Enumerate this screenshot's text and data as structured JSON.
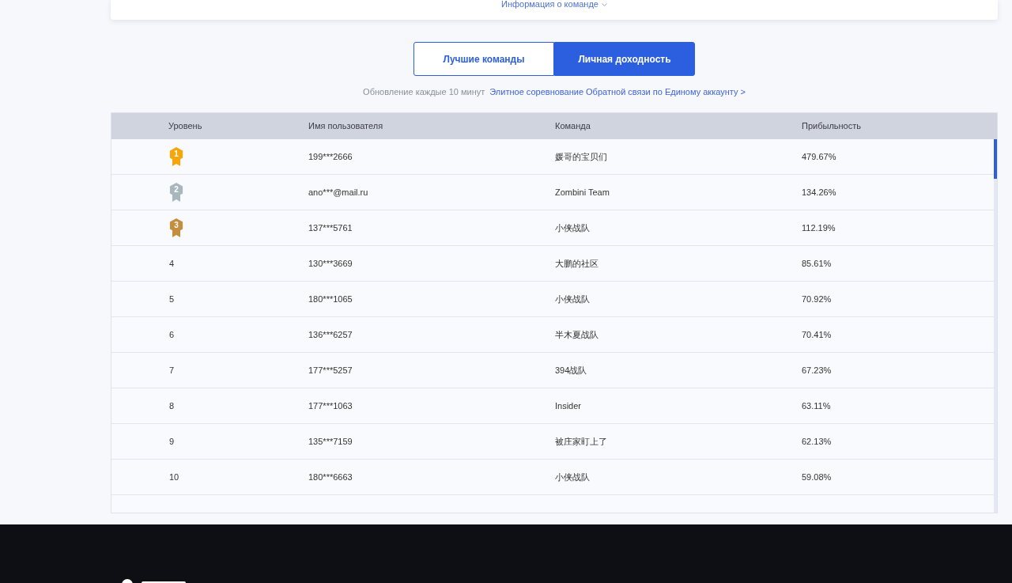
{
  "team_info": {
    "label": "Информация о команде"
  },
  "tabs": [
    {
      "label": "Лучшие команды",
      "selected": false
    },
    {
      "label": "Личная доходность",
      "selected": true
    }
  ],
  "update_note": {
    "text": "Обновление каждые 10 минут",
    "link": "Элитное соревнование Обратной связи по Единому аккаунту >"
  },
  "table": {
    "columns": [
      "Уровень",
      "Имя пользователя",
      "Команда",
      "Прибыльность"
    ],
    "rows": [
      {
        "kind": "medal",
        "rank": "1",
        "color": "#f5a70a",
        "user": "199***2666",
        "team": "媛哥的宝贝们",
        "profit": "479.67%"
      },
      {
        "kind": "medal",
        "rank": "2",
        "color": "#a8b7be",
        "user": "ano***@mail.ru",
        "team": "Zombini Team",
        "profit": "134.26%"
      },
      {
        "kind": "medal",
        "rank": "3",
        "color": "#c38f3e",
        "user": "137***5761",
        "team": "小侠战队",
        "profit": "112.19%"
      },
      {
        "kind": "plain",
        "rank": "4",
        "user": "130***3669",
        "team": "大鹏的社区",
        "profit": "85.61%"
      },
      {
        "kind": "plain",
        "rank": "5",
        "user": "180***1065",
        "team": "小侠战队",
        "profit": "70.92%"
      },
      {
        "kind": "plain",
        "rank": "6",
        "user": "136***6257",
        "team": "半木夏战队",
        "profit": "70.41%"
      },
      {
        "kind": "plain",
        "rank": "7",
        "user": "177***5257",
        "team": "394战队",
        "profit": "67.23%"
      },
      {
        "kind": "plain",
        "rank": "8",
        "user": "177***1063",
        "team": "Insider",
        "profit": "63.11%"
      },
      {
        "kind": "plain",
        "rank": "9",
        "user": "135***7159",
        "team": "被庄家盯上了",
        "profit": "62.13%"
      },
      {
        "kind": "plain",
        "rank": "10",
        "user": "180***6663",
        "team": "小侠战队",
        "profit": "59.08%"
      }
    ]
  }
}
